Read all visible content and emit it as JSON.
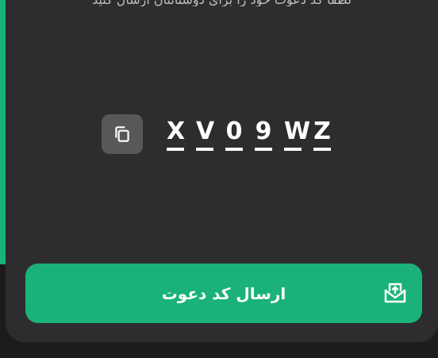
{
  "colors": {
    "accent": "#1bb27a",
    "card_background": "#2d2d2f",
    "page_background": "#1c1c1c",
    "copy_button": "#585858"
  },
  "header": {
    "partial_text": "لطفا کد دعوت خود را برای دوستانتان ارسال کنید"
  },
  "invite": {
    "code_chars": [
      "X",
      "V",
      "0",
      "9",
      "W",
      "Z"
    ],
    "copy_icon": "copy-icon"
  },
  "actions": {
    "send_label": "ارسال کد دعوت",
    "send_icon": "send-invite-icon"
  }
}
